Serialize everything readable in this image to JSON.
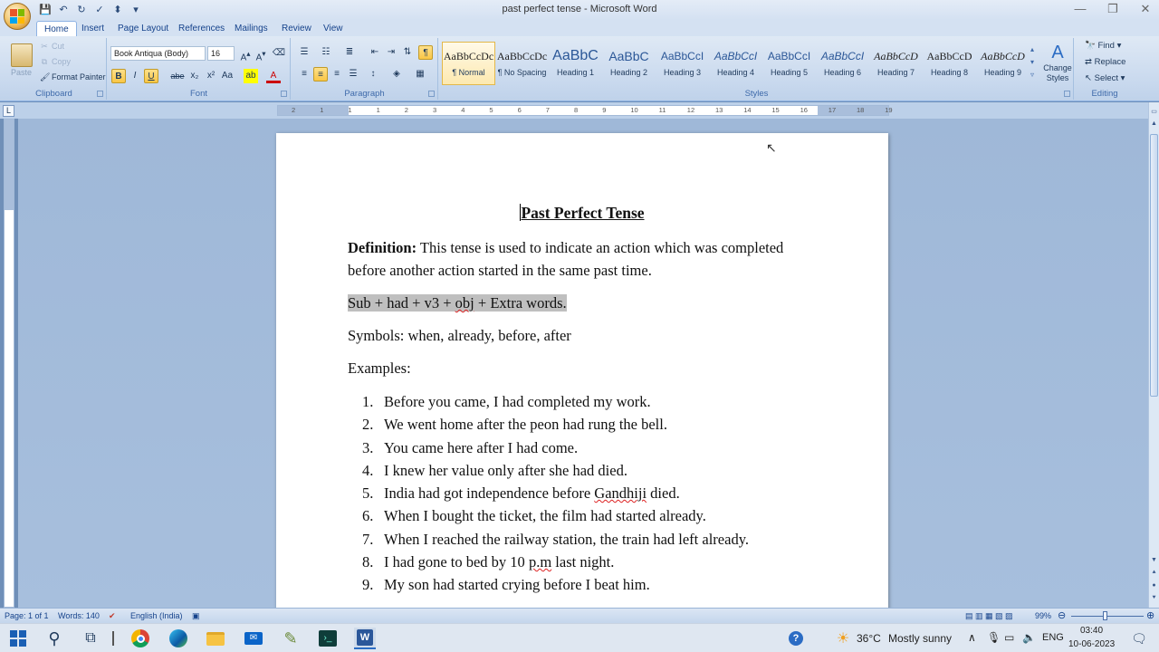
{
  "window": {
    "title": "past perfect tense - Microsoft Word",
    "min": "—",
    "max": "❐",
    "close": "✕"
  },
  "qat": [
    "💾",
    "↶",
    "↻",
    "✓",
    "⬍",
    "▾"
  ],
  "tabs": [
    "Home",
    "Insert",
    "Page Layout",
    "References",
    "Mailings",
    "Review",
    "View"
  ],
  "clipboard": {
    "paste": "Paste",
    "cut": "Cut",
    "copy": "Copy",
    "format_painter": "Format Painter",
    "label": "Clipboard"
  },
  "font": {
    "name": "Book Antiqua (Body)",
    "size": "16",
    "label": "Font",
    "buttons": [
      "B",
      "I",
      "U",
      "abe",
      "x₂",
      "x²",
      "Aa",
      "A"
    ]
  },
  "paragraph": {
    "label": "Paragraph"
  },
  "styles": {
    "label": "Styles",
    "items": [
      {
        "sample": "AaBbCcDc",
        "name": "¶ Normal"
      },
      {
        "sample": "AaBbCcDc",
        "name": "¶ No Spacing"
      },
      {
        "sample": "AaBbC",
        "name": "Heading 1"
      },
      {
        "sample": "AaBbC",
        "name": "Heading 2"
      },
      {
        "sample": "AaBbCcI",
        "name": "Heading 3"
      },
      {
        "sample": "AaBbCcI",
        "name": "Heading 4"
      },
      {
        "sample": "AaBbCcI",
        "name": "Heading 5"
      },
      {
        "sample": "AaBbCcI",
        "name": "Heading 6"
      },
      {
        "sample": "AaBbCcD",
        "name": "Heading 7"
      },
      {
        "sample": "AaBbCcD",
        "name": "Heading 8"
      },
      {
        "sample": "AaBbCcD",
        "name": "Heading 9"
      }
    ],
    "change_styles": "Change Styles"
  },
  "editing": {
    "label": "Editing",
    "find": "Find",
    "replace": "Replace",
    "select": "Select"
  },
  "ruler": {
    "numbers": [
      "2",
      "1",
      "1",
      "1",
      "2",
      "3",
      "4",
      "5",
      "6",
      "7",
      "8",
      "9",
      "10",
      "11",
      "12",
      "13",
      "14",
      "15",
      "16",
      "17",
      "18",
      "19"
    ]
  },
  "document": {
    "title": "Past Perfect Tense",
    "definition_label": "Definition:",
    "definition_text": " This tense is used to indicate an action which was completed before another action started in the same past time.",
    "structure_a": "Sub + had + v3 + ",
    "structure_obj": "obj",
    "structure_b": " + Extra words.",
    "symbols": "Symbols: when, already, before, after",
    "examples_label": "Examples:",
    "examples": [
      {
        "num": "1.",
        "text": "Before you came, I had completed my work."
      },
      {
        "num": "2.",
        "text": "We went home after the peon had rung the bell."
      },
      {
        "num": "3.",
        "text": "You came here after I had come."
      },
      {
        "num": "4.",
        "text": "I knew her value only after she had died."
      },
      {
        "num": "5.",
        "text_a": "India had got independence before ",
        "text_err": "Gandhiji",
        "text_b": " died."
      },
      {
        "num": "6.",
        "text": "When I bought the ticket, the film had started already."
      },
      {
        "num": "7.",
        "text": "When I reached the railway station, the train had left already."
      },
      {
        "num": "8.",
        "text_a": "I had gone to bed by 10 ",
        "text_err": "p.m",
        "text_b": " last night."
      },
      {
        "num": "9.",
        "text": "My son had started crying before I beat him."
      }
    ]
  },
  "status": {
    "page": "Page: 1 of 1",
    "words": "Words: 140",
    "language": "English (India)",
    "zoom": "99%"
  },
  "taskbar": {
    "weather_temp": "36°C",
    "weather_desc": "Mostly sunny",
    "lang": "ENG",
    "time": "03:40",
    "date": "10-06-2023"
  }
}
